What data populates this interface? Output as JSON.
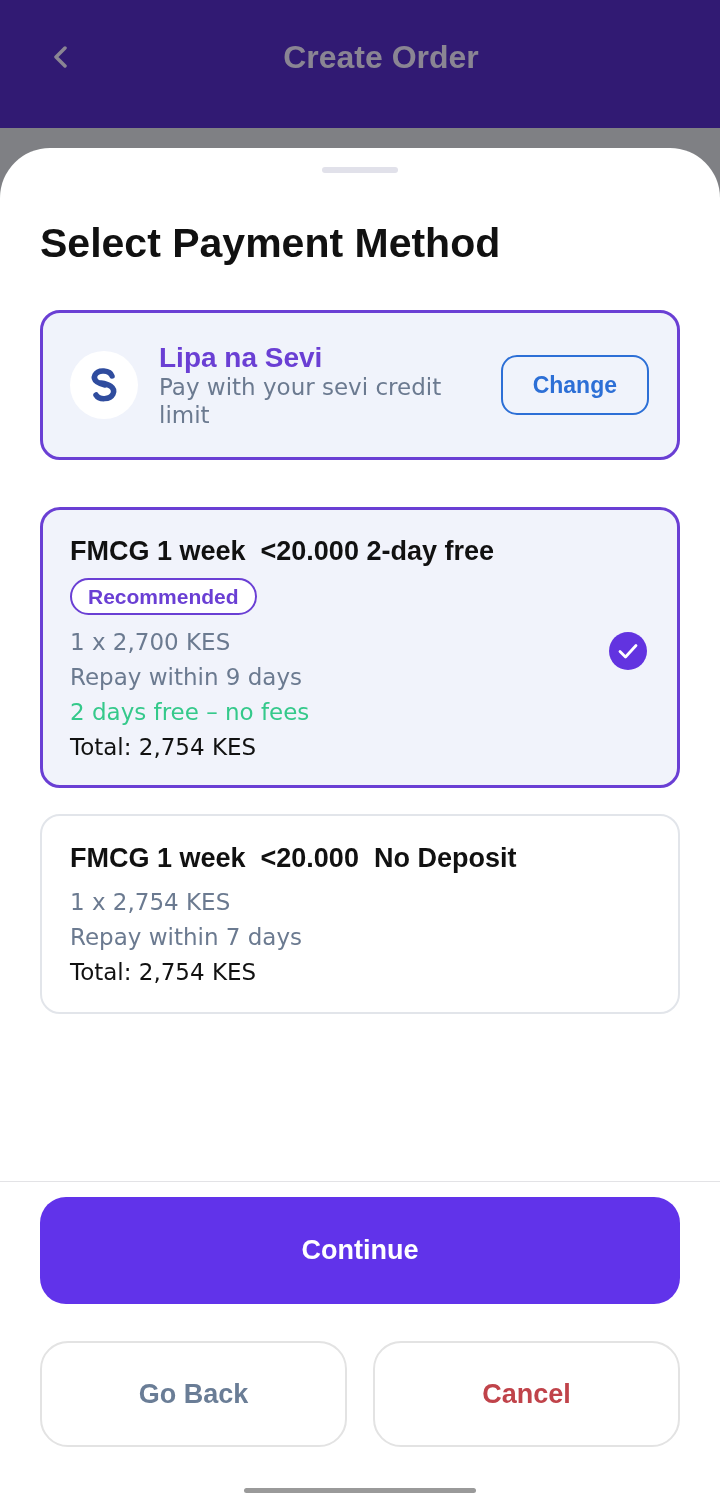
{
  "header": {
    "title": "Create Order"
  },
  "sheet": {
    "title": "Select Payment Method",
    "method": {
      "name": "Lipa na Sevi",
      "description": "Pay with your sevi credit limit",
      "button": "Change"
    },
    "plans": [
      {
        "title": "FMCG 1 week  <20.000 2-day free",
        "badge": "Recommended",
        "selected": true,
        "details": [
          {
            "kind": "muted",
            "text": "1 x 2,700 KES"
          },
          {
            "kind": "muted",
            "text": "Repay within 9 days"
          },
          {
            "kind": "highlight",
            "text": "2 days free – no fees"
          },
          {
            "kind": "total",
            "text": "Total: 2,754 KES"
          }
        ]
      },
      {
        "title": "FMCG 1 week  <20.000  No Deposit",
        "selected": false,
        "details": [
          {
            "kind": "muted",
            "text": "1 x 2,754 KES"
          },
          {
            "kind": "muted",
            "text": "Repay within 7 days"
          },
          {
            "kind": "total",
            "text": "Total: 2,754 KES"
          }
        ]
      }
    ]
  },
  "actions": {
    "primary": "Continue",
    "secondary": [
      {
        "label": "Go Back",
        "kind": "neutral"
      },
      {
        "label": "Cancel",
        "kind": "danger"
      }
    ]
  }
}
